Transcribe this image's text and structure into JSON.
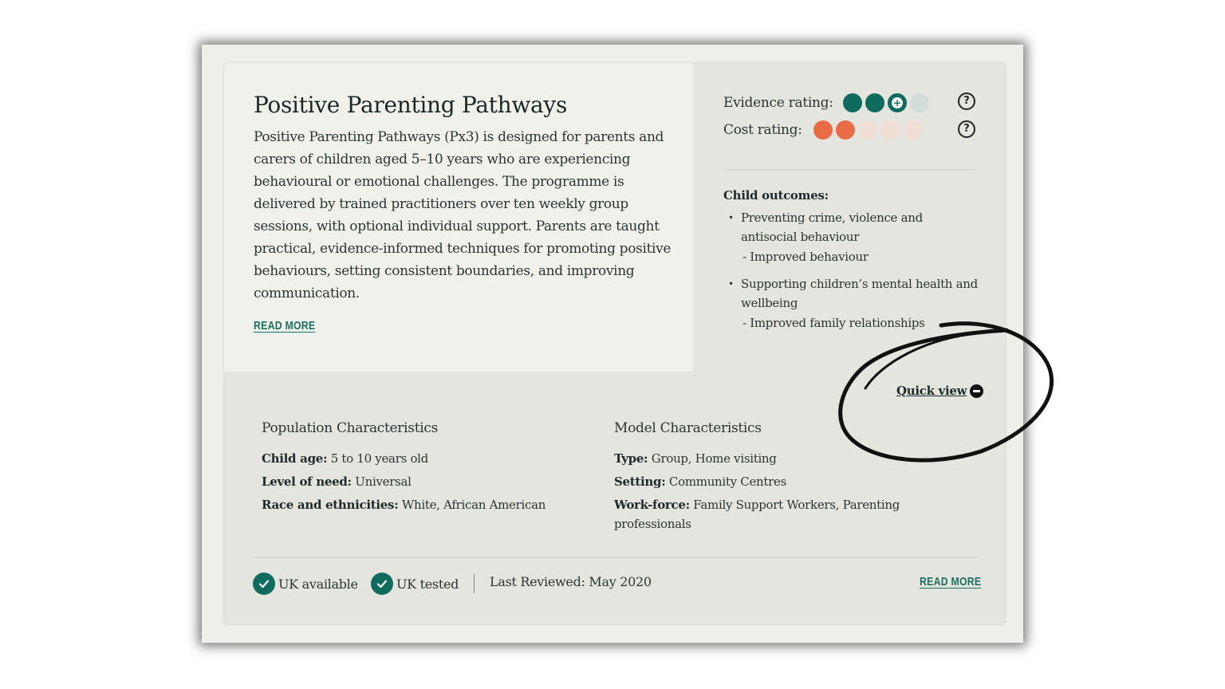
{
  "program": {
    "title": "Positive Parenting Pathways",
    "description": "Positive Parenting Pathways (Px3) is designed for parents and carers of children aged 5–10 years who are experiencing behavioural or emotional challenges. The programme is delivered by trained practitioners over ten weekly group sessions, with optional individual support. Parents are taught practical, evidence-informed techniques for promoting positive behaviours, setting consistent boundaries, and improving communication.",
    "read_more_label": "READ MORE"
  },
  "ratings": {
    "evidence": {
      "label": "Evidence rating:",
      "filled": 2,
      "plus": true,
      "total": 4,
      "help_icon": "question-circle-icon"
    },
    "cost": {
      "label": "Cost rating:",
      "filled": 2,
      "total": 5,
      "help_icon": "question-circle-icon"
    },
    "help_glyph": "?"
  },
  "outcomes": {
    "heading": "Child outcomes:",
    "items": [
      {
        "label": "Preventing crime, violence and antisocial behaviour",
        "sub": "- Improved behaviour"
      },
      {
        "label": "Supporting children’s mental health and wellbeing",
        "sub": "- Improved family relationships"
      }
    ]
  },
  "quick_view": {
    "label": "Quick view",
    "icon": "minus-circle-icon"
  },
  "population": {
    "heading": "Population Characteristics",
    "rows": [
      {
        "key": "Child age:",
        "value": " 5 to 10 years old"
      },
      {
        "key": "Level of need:",
        "value": " Universal"
      },
      {
        "key": "Race and ethnicities:",
        "value": " White, African American"
      }
    ]
  },
  "model": {
    "heading": "Model Characteristics",
    "rows": [
      {
        "key": "Type:",
        "value": " Group, Home visiting"
      },
      {
        "key": "Setting:",
        "value": " Community Centres"
      },
      {
        "key": "Work-force:",
        "value": " Family Support Workers, Parenting professionals"
      }
    ]
  },
  "footer": {
    "uk_available": "UK available",
    "uk_tested": "UK tested",
    "last_reviewed": "Last Reviewed: May 2020",
    "read_more_label": "READ MORE"
  },
  "colors": {
    "evidence": "#0e6b5d",
    "cost": "#ea6c46",
    "link": "#1d6f62",
    "annotation": "#111111"
  }
}
